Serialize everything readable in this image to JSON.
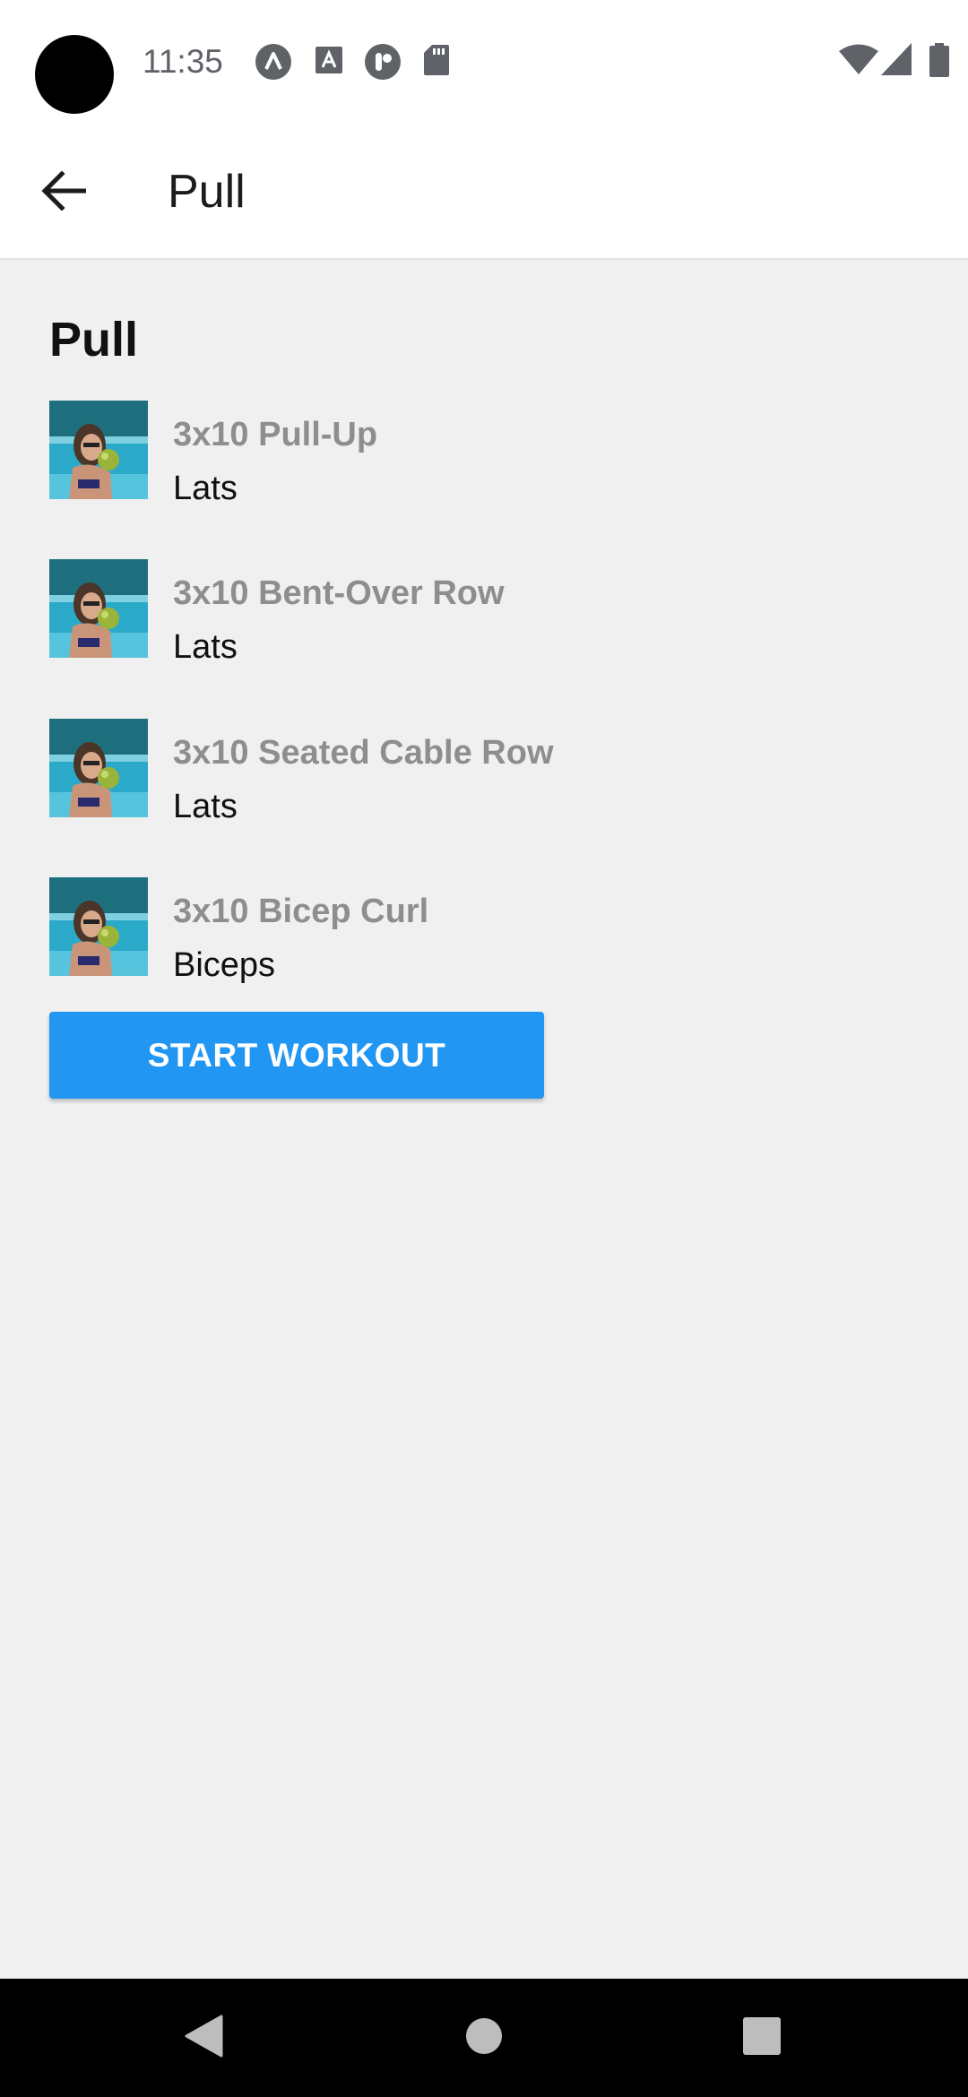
{
  "status_bar": {
    "time": "11:35",
    "notification_icons": [
      "app-a-icon",
      "font-icon",
      "pill-icon",
      "sd-card-icon"
    ],
    "system_icons": [
      "wifi-icon",
      "signal-icon",
      "battery-icon"
    ]
  },
  "app_bar": {
    "back_icon": "arrow-left-icon",
    "title": "Pull"
  },
  "workout": {
    "title": "Pull",
    "exercises": [
      {
        "name": "3x10 Pull-Up",
        "muscle": "Lats"
      },
      {
        "name": "3x10 Bent-Over Row",
        "muscle": "Lats"
      },
      {
        "name": "3x10 Seated Cable Row",
        "muscle": "Lats"
      },
      {
        "name": "3x10 Bicep Curl",
        "muscle": "Biceps"
      }
    ],
    "start_button_label": "START WORKOUT"
  },
  "nav_bar": {
    "back": "triangle-back-icon",
    "home": "circle-home-icon",
    "recents": "square-recents-icon"
  },
  "colors": {
    "accent": "#2196f3",
    "background": "#f0f0f0",
    "exercise_name": "#8e8e8e"
  }
}
